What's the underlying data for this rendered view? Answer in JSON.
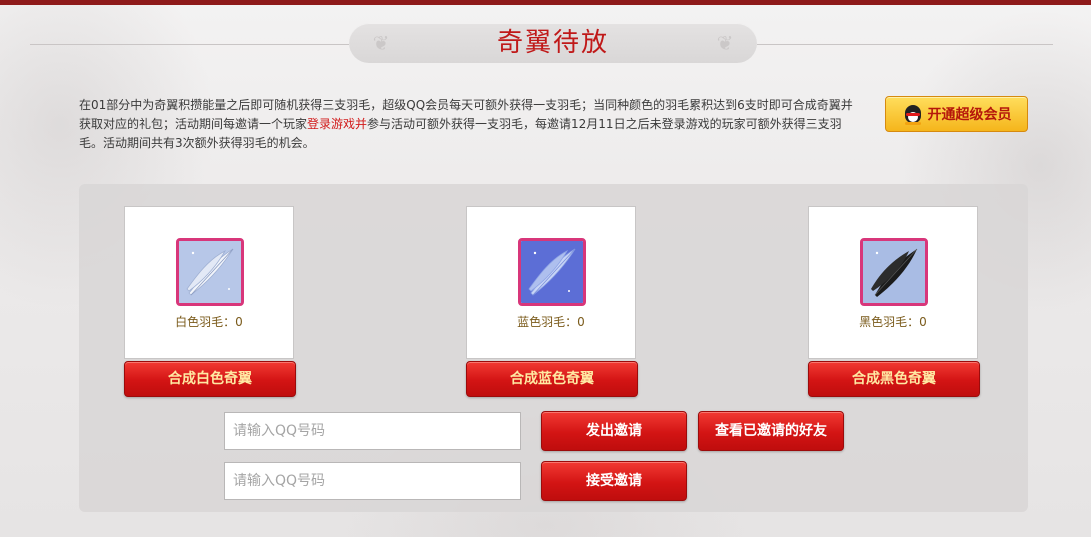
{
  "title": "奇翼待放",
  "description": {
    "part1": "在01部分中为奇翼积攒能量之后即可随机获得三支羽毛，超级QQ会员每天可额外获得一支羽毛；当同种颜色的羽毛累积达到6支时即可合成奇翼并获取对应的礼包；活动期间每邀请一个玩家",
    "highlight": "登录游戏并",
    "part2": "参与活动可额外获得一支羽毛，每邀请12月11日之后未登录游戏的玩家可额外获得三支羽毛。活动期间共有3次额外获得羽毛的机会。"
  },
  "vip_button": {
    "label": "开通超级会员",
    "icon": "qq-penguin-icon"
  },
  "feathers": [
    {
      "id": "white",
      "count_label": "白色羽毛：0",
      "button_label": "合成白色奇翼",
      "bg": "#b7c7e8",
      "feather": "#f2f5fb"
    },
    {
      "id": "blue",
      "count_label": "蓝色羽毛：0",
      "button_label": "合成蓝色奇翼",
      "bg": "#5c6ed6",
      "feather": "#c9d6f6"
    },
    {
      "id": "black",
      "count_label": "黑色羽毛：0",
      "button_label": "合成黑色奇翼",
      "bg": "#a9bce4",
      "feather": "#1b1b1b"
    }
  ],
  "invite": {
    "input_placeholder": "请输入QQ号码",
    "send_label": "发出邀请",
    "view_label": "查看已邀请的好友",
    "accept_placeholder": "请输入QQ号码",
    "accept_label": "接受邀请"
  },
  "colors": {
    "accent": "#c01919",
    "topbar": "#8e1a1a",
    "button_red": "#d31414"
  }
}
